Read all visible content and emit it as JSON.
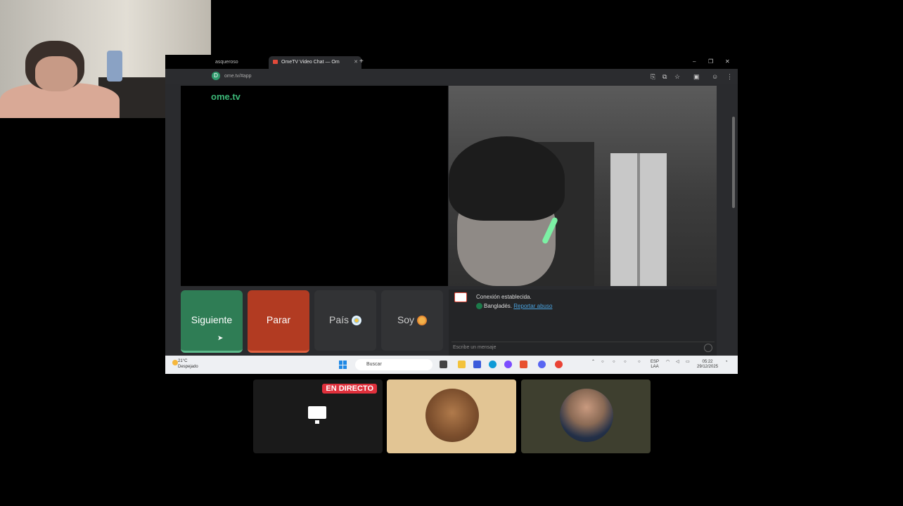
{
  "browser": {
    "tabs": [
      {
        "label": "asqueroso",
        "active": false
      },
      {
        "label": "OmeTV Video Chat — Om",
        "active": true
      }
    ],
    "url": "ome.tv/#app",
    "site_logo": {
      "part1": "ome",
      "part2": ".tv"
    }
  },
  "controls": {
    "next_label": "Siguiente",
    "stop_label": "Parar",
    "country_label": "País",
    "soy_label": "Soy"
  },
  "chat": {
    "status": "Conexión establecida.",
    "country": "Bangladés.",
    "report_link": "Reportar abuso",
    "input_placeholder": "Escribe un mensaje"
  },
  "taskbar": {
    "weather_temp": "21°C",
    "weather_desc": "Despejado",
    "search_label": "Buscar",
    "lang": "ESP",
    "lang_sub": "LAA",
    "time": "05:22",
    "date": "29/12/2025"
  },
  "stream": {
    "live_badge": "EN DIRECTO"
  },
  "colors": {
    "next": "#2f7d55",
    "stop": "#b23b22",
    "live": "#e0303c",
    "link": "#4aa3df"
  }
}
